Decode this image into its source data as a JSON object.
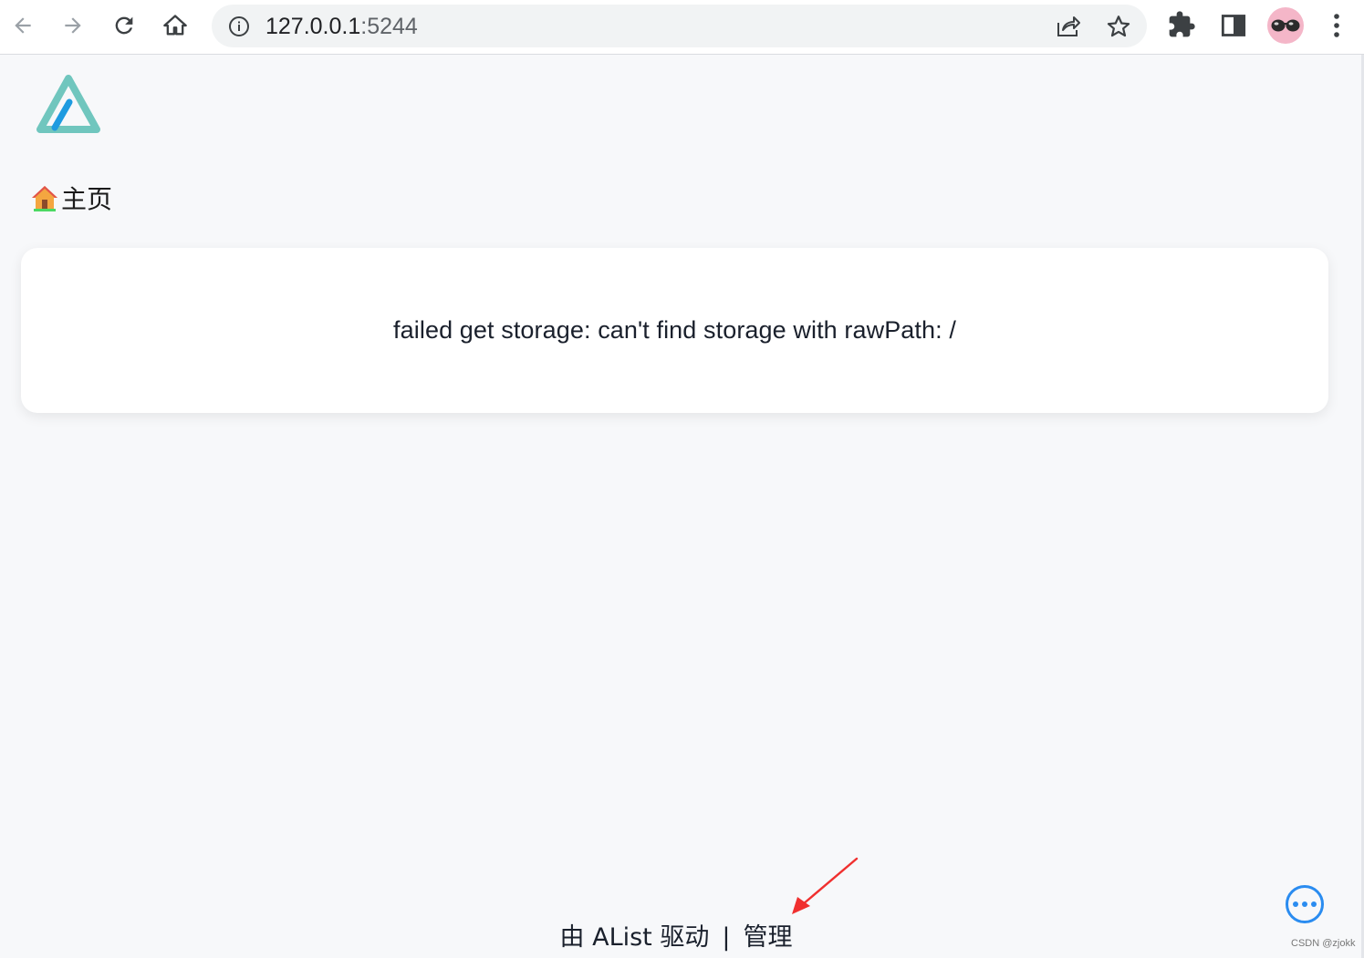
{
  "browser": {
    "url_host": "127.0.0.1",
    "url_port": ":5244"
  },
  "page": {
    "breadcrumb": {
      "home_label": "主页"
    },
    "error_message": "failed get storage: can't find storage with rawPath: /",
    "footer": {
      "powered_by": "由 AList 驱动",
      "separator": "|",
      "manage_label": "管理"
    }
  },
  "colors": {
    "accent": "#2a8cf0",
    "logo_teal": "#70c6be",
    "logo_blue": "#1e9be0",
    "annotation_arrow": "#f0302f"
  },
  "watermark": "CSDN @zjokk"
}
